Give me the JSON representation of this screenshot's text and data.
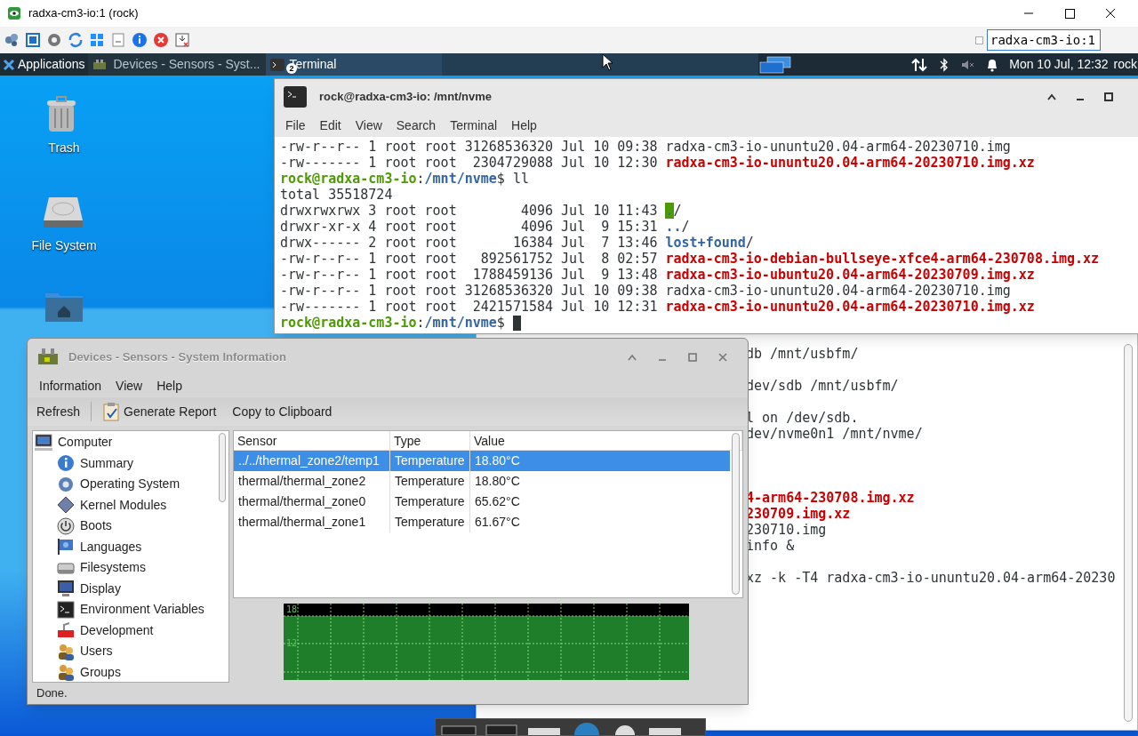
{
  "viewer": {
    "title": "radxa-cm3-io:1 (rock)",
    "host_checkbox": {
      "checked": false
    },
    "host_field": {
      "value": "radxa-cm3-io:1"
    }
  },
  "taskbar": {
    "apps_label": "Applications",
    "tasks": [
      {
        "label": "Devices - Sensors - Syst...",
        "selected": false,
        "kind": "sensors"
      },
      {
        "label": "Terminal",
        "selected": true,
        "kind": "terminal",
        "badge": "2"
      }
    ],
    "clock": "Mon 10 Jul, 12:32",
    "user": "rock"
  },
  "desktop_icons": [
    {
      "kind": "trash",
      "label": "Trash"
    },
    {
      "kind": "drive",
      "label": "File System"
    },
    {
      "kind": "home"
    }
  ],
  "terminal": {
    "title": "rock@radxa-cm3-io: /mnt/nvme",
    "menu": [
      "File",
      "Edit",
      "View",
      "Search",
      "Terminal",
      "Help"
    ],
    "lines": [
      [
        {
          "text": "-rw-r--r-- 1 root root 31268536320 Jul 10 09:38 ",
          "kind": "plain"
        },
        {
          "text": "radxa-cm3-io-ununtu20.04-arm64-20230710.img",
          "kind": "plain"
        }
      ],
      [
        {
          "text": "-rw------- 1 root root  2304729088 Jul 10 12:30 ",
          "kind": "plain"
        },
        {
          "text": "radxa-cm3-io-ununtu20.04-arm64-20230710.img.xz",
          "kind": "archive"
        }
      ],
      [
        {
          "text": "rock@radxa-cm3-io",
          "kind": "user"
        },
        {
          "text": ":",
          "kind": "plain"
        },
        {
          "text": "/mnt/nvme",
          "kind": "dir"
        },
        {
          "text": "$ ll",
          "kind": "plain"
        }
      ],
      [
        {
          "text": "total 35518724",
          "kind": "plain"
        }
      ],
      [
        {
          "text": "drwxrwxrwx 3 root root        4096 Jul 10 11:43 ",
          "kind": "plain"
        },
        {
          "text": ".",
          "kind": "sticky"
        },
        {
          "text": "/",
          "kind": "plain"
        }
      ],
      [
        {
          "text": "drwxr-xr-x 4 root root        4096 Jul  9 15:31 ",
          "kind": "plain"
        },
        {
          "text": "..",
          "kind": "dir"
        },
        {
          "text": "/",
          "kind": "plain"
        }
      ],
      [
        {
          "text": "drwx------ 2 root root       16384 Jul  7 13:46 ",
          "kind": "plain"
        },
        {
          "text": "lost+found",
          "kind": "dir"
        },
        {
          "text": "/",
          "kind": "plain"
        }
      ],
      [
        {
          "text": "-rw-r--r-- 1 root root   892561752 Jul  8 02:57 ",
          "kind": "plain"
        },
        {
          "text": "radxa-cm3-io-debian-bullseye-xfce4-arm64-230708.img.xz",
          "kind": "archive"
        }
      ],
      [
        {
          "text": "-rw-r--r-- 1 root root  1788459136 Jul  9 13:48 ",
          "kind": "plain"
        },
        {
          "text": "radxa-cm3-io-ubuntu20.04-arm64-20230709.img.xz",
          "kind": "archive"
        }
      ],
      [
        {
          "text": "-rw-r--r-- 1 root root 31268536320 Jul 10 09:38 ",
          "kind": "plain"
        },
        {
          "text": "radxa-cm3-io-ununtu20.04-arm64-20230710.img",
          "kind": "plain"
        }
      ],
      [
        {
          "text": "-rw------- 1 root root  2421571584 Jul 10 12:31 ",
          "kind": "plain"
        },
        {
          "text": "radxa-cm3-io-ununtu20.04-arm64-20230710.img.xz",
          "kind": "archive"
        }
      ],
      [
        {
          "text": "rock@radxa-cm3-io",
          "kind": "user"
        },
        {
          "text": ":",
          "kind": "plain"
        },
        {
          "text": "/mnt/nvme",
          "kind": "dir"
        },
        {
          "text": "$ ",
          "kind": "plain"
        },
        {
          "kind": "cursor"
        }
      ]
    ]
  },
  "back_terminal": {
    "lines": [
      [
        {
          "text": "db /mnt/usbfm/",
          "kind": "plain"
        }
      ],
      [
        {
          "text": "dev/sdb /mnt/usbfm/",
          "kind": "plain"
        }
      ],
      [
        {
          "text": "l on /dev/sdb.",
          "kind": "plain"
        }
      ],
      [
        {
          "text": "dev/nvme0n1 /mnt/nvme/",
          "kind": "plain"
        }
      ],
      [
        {
          "text": "4-arm64-230708.img.xz",
          "kind": "archive"
        }
      ],
      [
        {
          "text": "230709.img.xz",
          "kind": "archive"
        }
      ],
      [
        {
          "text": "230710.img",
          "kind": "plain"
        }
      ],
      [
        {
          "text": "info &",
          "kind": "plain"
        }
      ],
      [
        {
          "text": "xz -k -T4 radxa-cm3-io-ununtu20.04-arm64-20230",
          "kind": "plain"
        }
      ]
    ]
  },
  "sysinfo": {
    "title": "Devices - Sensors - System Information",
    "menu": [
      "Information",
      "View",
      "Help"
    ],
    "toolbar": [
      {
        "label": "Refresh",
        "kind": "text"
      },
      {
        "label": "Generate Report",
        "kind": "report"
      },
      {
        "label": "Copy to Clipboard",
        "kind": "text"
      }
    ],
    "tree": [
      {
        "label": "Computer",
        "kind": "computer",
        "children": [
          {
            "label": "Summary",
            "kind": "info"
          },
          {
            "label": "Operating System",
            "kind": "gear"
          },
          {
            "label": "Kernel Modules",
            "kind": "diamond"
          },
          {
            "label": "Boots",
            "kind": "power"
          },
          {
            "label": "Languages",
            "kind": "flag"
          },
          {
            "label": "Filesystems",
            "kind": "drive"
          },
          {
            "label": "Display",
            "kind": "monitor"
          },
          {
            "label": "Environment Variables",
            "kind": "terminal"
          },
          {
            "label": "Development",
            "kind": "tool"
          },
          {
            "label": "Users",
            "kind": "people"
          },
          {
            "label": "Groups",
            "kind": "people"
          }
        ]
      }
    ],
    "table": {
      "columns": [
        "Sensor",
        "Type",
        "Value"
      ],
      "rows": [
        {
          "cells": [
            "../../thermal_zone2/temp1",
            "Temperature",
            "18.80°C"
          ],
          "selected": true
        },
        {
          "cells": [
            "thermal/thermal_zone2",
            "Temperature",
            "18.80°C"
          ],
          "selected": false
        },
        {
          "cells": [
            "thermal/thermal_zone0",
            "Temperature",
            "65.62°C"
          ],
          "selected": false
        },
        {
          "cells": [
            "thermal/thermal_zone1",
            "Temperature",
            "61.67°C"
          ],
          "selected": false
        }
      ]
    },
    "graph_labels": [
      "18",
      "12"
    ],
    "status": "Done."
  }
}
